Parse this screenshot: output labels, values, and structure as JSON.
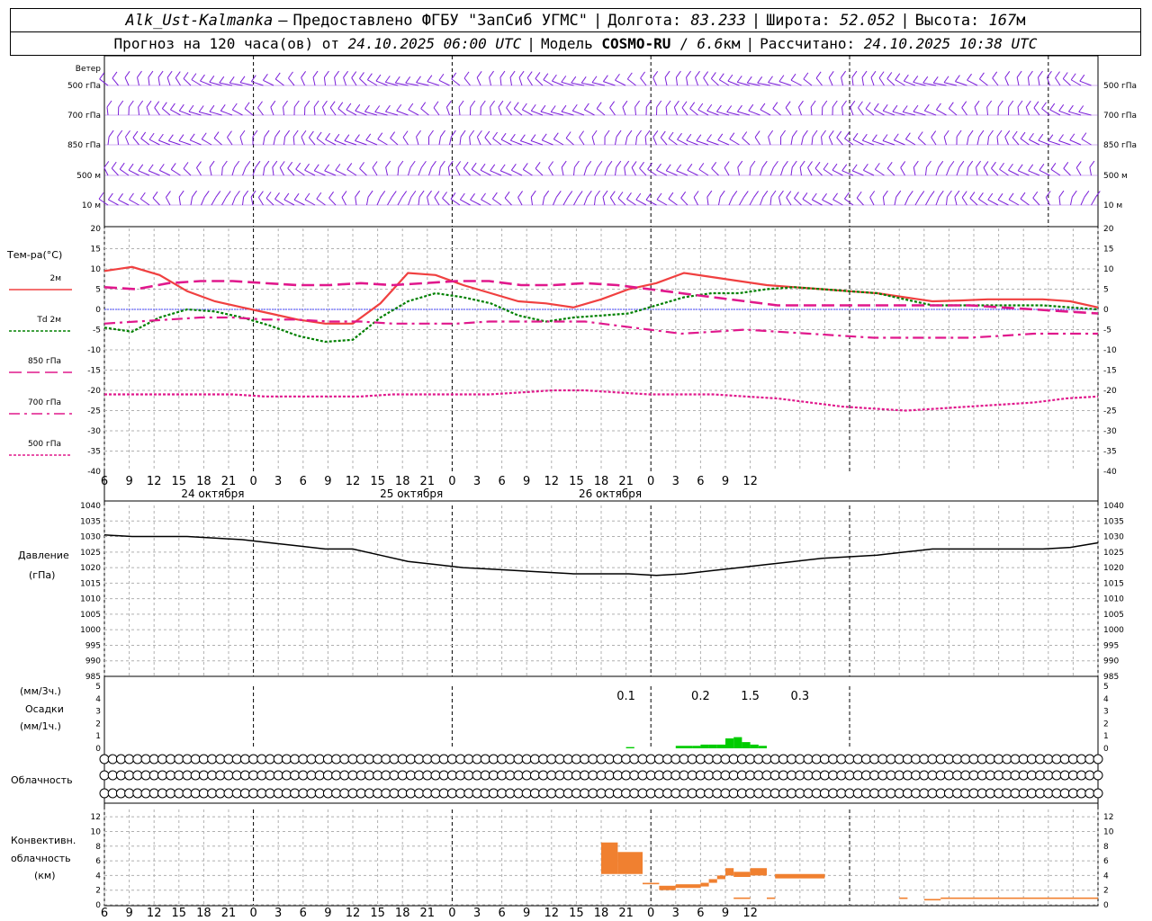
{
  "header": {
    "station": "Alk_Ust-Kalmanka",
    "dash": "—",
    "provider": "Предоставлено ФГБУ \"ЗапСиб УГМС\"",
    "lon_label": "Долгота:",
    "lon": "83.233",
    "lat_label": "Широта:",
    "lat": "52.052",
    "alt_label": "Высота:",
    "alt": "167",
    "alt_unit": "м",
    "sep": "|",
    "forecast_label": "Прогноз на 120 часа(ов) от",
    "forecast_start": "24.10.2025 06:00 UTC",
    "model_label": "Модель",
    "model": "COSMO-RU",
    "slash": "/",
    "res": "6.6",
    "res_unit": "км",
    "calc_label": "Рассчитано:",
    "calc_time": "24.10.2025 10:38 UTC"
  },
  "colors": {
    "t2m": "#f04040",
    "td2m": "#008000",
    "t850": "#e0188c",
    "wind": "#7b1fd9",
    "pressure": "#000000",
    "precip": "#00cc00",
    "conv": "#f08030",
    "grid": "#b0b0b0",
    "zero_line": "#4040ff"
  },
  "wind": {
    "title": "Ветер",
    "levels": [
      "500 гПа",
      "700 гПа",
      "850 гПа",
      "500 м",
      "10 м"
    ]
  },
  "temp": {
    "title": "Тем-ра(°С)",
    "legend": [
      "2м",
      "Td 2м",
      "850 гПа",
      "700 гПа",
      "500 гПа"
    ]
  },
  "pressure": {
    "title_line1": "Давление",
    "title_line2": "(гПа)"
  },
  "precip": {
    "title_line1": "(мм/3ч.)",
    "title_line2": "Осадки",
    "title_line3": "(мм/1ч.)"
  },
  "cloud": {
    "title": "Облачность"
  },
  "conv": {
    "title_line1": "Конвективн.",
    "title_line2": "облачность",
    "title_line3": "(км)"
  },
  "time_axis": {
    "hour_labels": [
      "6",
      "9",
      "12",
      "15",
      "18",
      "21",
      "0",
      "3",
      "6",
      "9",
      "12",
      "15",
      "18",
      "21",
      "0",
      "3",
      "6",
      "9",
      "12",
      "15",
      "18",
      "21",
      "0",
      "3",
      "6",
      "9",
      "12"
    ],
    "days": [
      "24 октября",
      "25 октября",
      "26 октября"
    ]
  },
  "chart_data": [
    {
      "type": "line",
      "name": "temperature",
      "x_hours": [
        0,
        3,
        6,
        9,
        12,
        15,
        18,
        21,
        24,
        27,
        30,
        33,
        36,
        39,
        42,
        45,
        48,
        51,
        54,
        57,
        60,
        63,
        66,
        69,
        72,
        75,
        78,
        81,
        84,
        87,
        90,
        93,
        96,
        99,
        102,
        105,
        108,
        111,
        114,
        117,
        120
      ],
      "ylim": [
        -40,
        20
      ],
      "yticks": [
        20,
        15,
        10,
        5,
        0,
        -5,
        -10,
        -15,
        -20,
        -25,
        -30,
        -35,
        -40
      ],
      "series": [
        {
          "name": "2м",
          "values": [
            9.5,
            10.5,
            8.5,
            4.5,
            2,
            0.5,
            -1,
            -2.5,
            -3.5,
            -3.5,
            1.5,
            9,
            8.5,
            6,
            4,
            2,
            1.5,
            0.5,
            2.5,
            5,
            6.5,
            9,
            8,
            7,
            6,
            5.5,
            5,
            4.5,
            4,
            3,
            2,
            2.2,
            2.5,
            2.5,
            2.5,
            2,
            0.5
          ]
        },
        {
          "name": "Td 2м",
          "values": [
            -4.5,
            -5.5,
            -2,
            0,
            -0.5,
            -2,
            -4,
            -6.5,
            -8,
            -7.5,
            -2,
            2,
            4,
            3,
            1.5,
            -1.5,
            -3,
            -2,
            -1.5,
            -1,
            1,
            3,
            4,
            4,
            5,
            5.5,
            5,
            4.5,
            4,
            2.5,
            1,
            1,
            1,
            1,
            1,
            0.5,
            0
          ]
        },
        {
          "name": "850 гПа",
          "values": [
            5.5,
            5,
            6.5,
            7,
            7,
            6.5,
            6,
            6,
            6.5,
            6,
            6.5,
            7,
            7,
            6,
            6,
            6.5,
            6,
            5,
            4,
            3,
            2,
            1,
            1,
            1,
            1,
            1,
            1,
            1,
            0.5,
            0,
            -0.5,
            -1
          ]
        },
        {
          "name": "700 гПа",
          "values": [
            -3.5,
            -3,
            -2.5,
            -2,
            -2,
            -2.5,
            -2.5,
            -3,
            -3,
            -3.5,
            -3.5,
            -3.5,
            -3,
            -3,
            -3,
            -3,
            -4,
            -5,
            -6,
            -5.5,
            -5,
            -5.5,
            -6,
            -6.5,
            -7,
            -7,
            -7,
            -7,
            -6.5,
            -6,
            -6,
            -6
          ]
        },
        {
          "name": "500 гПа",
          "values": [
            -21,
            -21,
            -21,
            -21,
            -21,
            -21.5,
            -21.5,
            -21.5,
            -21.5,
            -21,
            -21,
            -21,
            -21,
            -20.5,
            -20,
            -20,
            -20.5,
            -21,
            -21,
            -21,
            -21.5,
            -22,
            -23,
            -24,
            -24.5,
            -25,
            -24.5,
            -24,
            -23.5,
            -23,
            -22,
            -21.5
          ]
        }
      ]
    },
    {
      "type": "line",
      "name": "pressure",
      "ylim": [
        985,
        1040
      ],
      "yticks": [
        1040,
        1035,
        1030,
        1025,
        1020,
        1015,
        1010,
        1005,
        1000,
        995,
        990,
        985
      ],
      "x_hours": [
        0,
        3,
        6,
        9,
        12,
        15,
        18,
        21,
        24,
        27,
        30,
        33,
        36,
        39,
        42,
        45,
        48,
        51,
        54,
        57,
        60,
        63,
        66,
        69,
        72,
        75,
        78,
        81,
        84,
        87,
        90,
        93,
        96,
        99,
        102,
        105,
        108,
        111,
        114,
        117,
        120
      ],
      "values": [
        1030.5,
        1030,
        1030,
        1030,
        1029.5,
        1029,
        1028,
        1027,
        1026,
        1026,
        1024,
        1022,
        1021,
        1020,
        1019.5,
        1019,
        1018.5,
        1018,
        1018,
        1018,
        1017.5,
        1018,
        1019,
        1020,
        1021,
        1022,
        1023,
        1023.5,
        1024,
        1025,
        1026,
        1026,
        1026,
        1026,
        1026,
        1026.5,
        1028
      ]
    },
    {
      "type": "bar",
      "name": "precipitation",
      "ylim": [
        0,
        5
      ],
      "yticks": [
        5,
        4,
        3,
        2,
        1,
        0
      ],
      "labels_3h": [
        "0.1",
        "0.2",
        "1.5",
        "0.3"
      ],
      "label_hours": [
        63,
        72,
        78,
        84
      ],
      "bars_1h": [
        {
          "h": 63,
          "v": 0.1
        },
        {
          "h": 69,
          "v": 0.2
        },
        {
          "h": 70,
          "v": 0.2
        },
        {
          "h": 71,
          "v": 0.2
        },
        {
          "h": 72,
          "v": 0.3
        },
        {
          "h": 73,
          "v": 0.3
        },
        {
          "h": 74,
          "v": 0.3
        },
        {
          "h": 75,
          "v": 0.8
        },
        {
          "h": 76,
          "v": 0.9
        },
        {
          "h": 77,
          "v": 0.5
        },
        {
          "h": 78,
          "v": 0.3
        },
        {
          "h": 79,
          "v": 0.2
        }
      ]
    },
    {
      "type": "bar",
      "name": "convective_cloud",
      "ylim": [
        0,
        13
      ],
      "yticks": [
        12,
        10,
        8,
        6,
        4,
        2,
        0
      ],
      "segments_km": [
        {
          "h0": 60,
          "h1": 62,
          "base": 4.2,
          "top": 8.5
        },
        {
          "h0": 62,
          "h1": 65,
          "base": 4.2,
          "top": 7.2
        },
        {
          "h0": 65,
          "h1": 67,
          "base": 2.8,
          "top": 3.0
        },
        {
          "h0": 67,
          "h1": 69,
          "base": 2.0,
          "top": 2.6
        },
        {
          "h0": 69,
          "h1": 72,
          "base": 2.3,
          "top": 2.8
        },
        {
          "h0": 72,
          "h1": 73,
          "base": 2.5,
          "top": 3.0
        },
        {
          "h0": 73,
          "h1": 74,
          "base": 3.0,
          "top": 3.5
        },
        {
          "h0": 74,
          "h1": 75,
          "base": 3.5,
          "top": 4.0
        },
        {
          "h0": 75,
          "h1": 76,
          "base": 4.0,
          "top": 5.0
        },
        {
          "h0": 76,
          "h1": 78,
          "base": 3.8,
          "top": 4.5
        },
        {
          "h0": 76,
          "h1": 78,
          "base": 0.8,
          "top": 1.0
        },
        {
          "h0": 78,
          "h1": 80,
          "base": 4.0,
          "top": 5.0
        },
        {
          "h0": 80,
          "h1": 81,
          "base": 0.8,
          "top": 1.0
        },
        {
          "h0": 81,
          "h1": 87,
          "base": 3.6,
          "top": 4.2
        },
        {
          "h0": 96,
          "h1": 97,
          "base": 0.8,
          "top": 1.0
        },
        {
          "h0": 99,
          "h1": 101,
          "base": 0.6,
          "top": 0.8
        },
        {
          "h0": 101,
          "h1": 120,
          "base": 0.8,
          "top": 1.0
        }
      ]
    },
    {
      "type": "table",
      "name": "cloud_cover",
      "rows": [
        "upper",
        "middle",
        "lower"
      ],
      "step_hours": 1,
      "upper": "0000000000000000000000000000000000000000000000000000000000000000000000000000000000000000000000000000000000000000000000000",
      "middle": "0000000000000000000000000000000000000000000000000000000000000000000000000000000000000000000000000000000000000000000000000",
      "lower": "0000000000000000000000000000000000000000000000000000000000000000000000000000000000000000000000000000000000000000000000000"
    }
  ]
}
